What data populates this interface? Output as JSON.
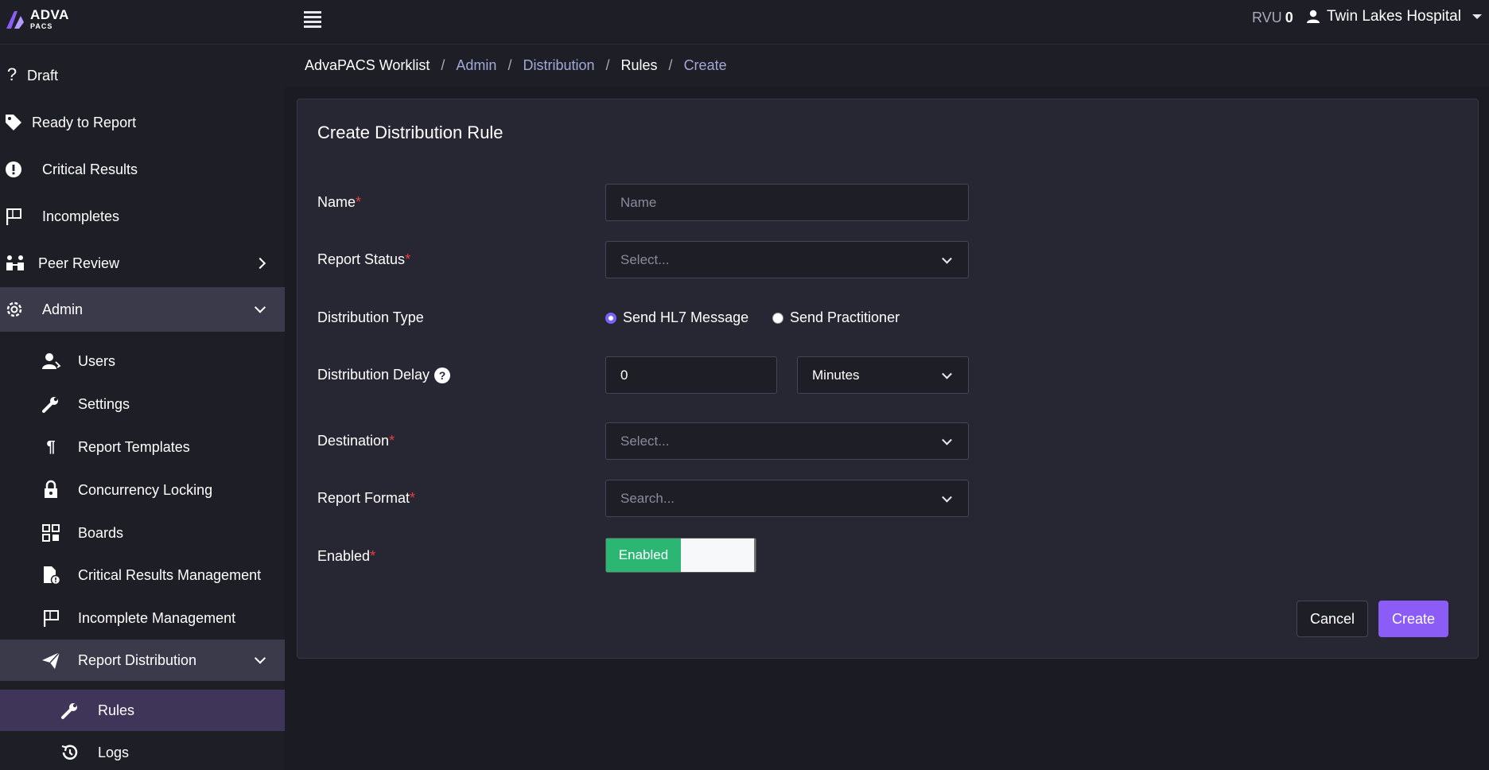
{
  "header": {
    "logo_text": "ADVA",
    "logo_sub": "PACS",
    "rvu_label": "RVU",
    "rvu_value": "0",
    "user_name": "Twin Lakes Hospital"
  },
  "sidebar": {
    "items": [
      {
        "label": "Draft",
        "icon": "question-icon"
      },
      {
        "label": "Ready to Report",
        "icon": "tag-icon"
      },
      {
        "label": "Critical Results",
        "icon": "alert-circle-icon"
      },
      {
        "label": "Incompletes",
        "icon": "flag-icon"
      },
      {
        "label": "Peer Review",
        "icon": "people-icon"
      },
      {
        "label": "Admin",
        "icon": "gear-icon"
      },
      {
        "label": "Users",
        "icon": "users-icon"
      },
      {
        "label": "Settings",
        "icon": "wrench-icon"
      },
      {
        "label": "Report Templates",
        "icon": "paragraph-icon"
      },
      {
        "label": "Concurrency Locking",
        "icon": "lock-icon"
      },
      {
        "label": "Boards",
        "icon": "boards-icon"
      },
      {
        "label": "Critical Results Management",
        "icon": "file-alert-icon"
      },
      {
        "label": "Incomplete Management",
        "icon": "flag-icon"
      },
      {
        "label": "Report Distribution",
        "icon": "paper-plane-icon"
      },
      {
        "label": "Rules",
        "icon": "wrench-icon"
      },
      {
        "label": "Logs",
        "icon": "history-icon"
      }
    ]
  },
  "breadcrumb": {
    "items": [
      "AdvaPACS Worklist",
      "Admin",
      "Distribution",
      "Rules",
      "Create"
    ],
    "separator": "/"
  },
  "form": {
    "title": "Create Distribution Rule",
    "name_label": "Name",
    "name_placeholder": "Name",
    "report_status_label": "Report Status",
    "report_status_placeholder": "Select...",
    "distribution_type_label": "Distribution Type",
    "radio_hl7": "Send HL7 Message",
    "radio_practitioner": "Send Practitioner",
    "distribution_delay_label": "Distribution Delay",
    "delay_value": "0",
    "delay_unit": "Minutes",
    "destination_label": "Destination",
    "destination_placeholder": "Select...",
    "report_format_label": "Report Format",
    "report_format_placeholder": "Search...",
    "enabled_label": "Enabled",
    "enabled_toggle": "Enabled",
    "required_mark": "*",
    "help_mark": "?",
    "cancel_label": "Cancel",
    "create_label": "Create"
  },
  "colors": {
    "accent": "#8b5cf6",
    "enabled_green": "#2bb673",
    "required_red": "#ee3b3b"
  }
}
